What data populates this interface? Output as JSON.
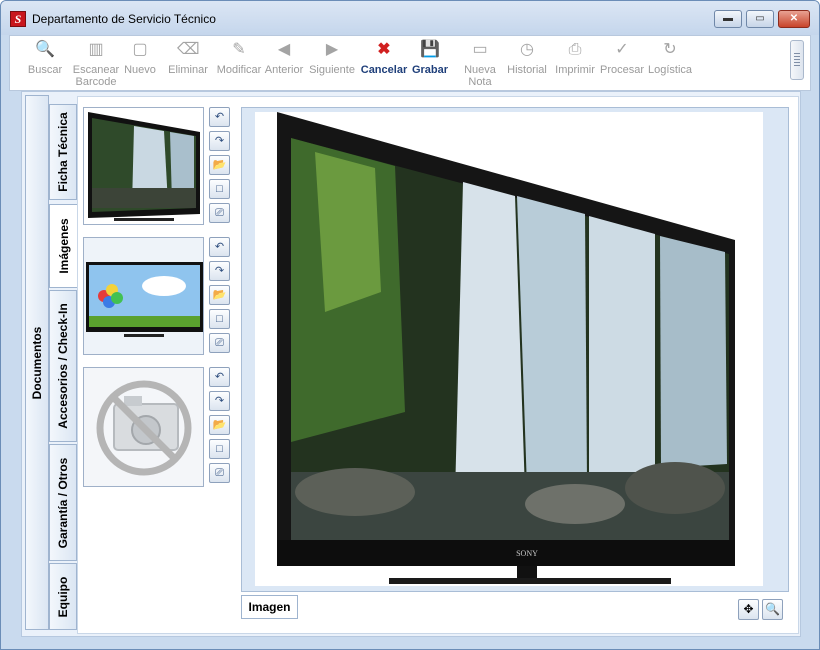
{
  "window": {
    "app_icon": "S",
    "title": "Departamento de Servicio Técnico",
    "controls": {
      "minimize": "▬",
      "maximize": "▭",
      "close": "✕"
    }
  },
  "toolbar": {
    "items": [
      {
        "label": "Buscar",
        "icon": "search-icon",
        "glyph": "🔍",
        "enabled": false
      },
      {
        "label": "Escanear",
        "label2": "Barcode",
        "icon": "barcode-icon",
        "glyph": "▥",
        "enabled": false
      },
      {
        "label": "Nuevo",
        "icon": "new-document-icon",
        "glyph": "▢",
        "enabled": false
      },
      {
        "label": "Eliminar",
        "icon": "delete-icon",
        "glyph": "⌫",
        "enabled": false
      },
      {
        "label": "Modificar",
        "icon": "edit-icon",
        "glyph": "✎",
        "enabled": false
      },
      {
        "label": "Anterior",
        "icon": "previous-icon",
        "glyph": "◀",
        "enabled": false
      },
      {
        "label": "Siguiente",
        "icon": "next-icon",
        "glyph": "▶",
        "enabled": false
      },
      {
        "label": "Cancelar",
        "icon": "cancel-icon",
        "glyph": "✖",
        "enabled": true
      },
      {
        "label": "Grabar",
        "icon": "save-icon",
        "glyph": "💾",
        "enabled": true
      },
      {
        "label": "Nueva",
        "label2": "Nota",
        "icon": "note-icon",
        "glyph": "▭",
        "enabled": false
      },
      {
        "label": "Historial",
        "icon": "history-icon",
        "glyph": "◷",
        "enabled": false
      },
      {
        "label": "Imprimir",
        "icon": "print-icon",
        "glyph": "⎙",
        "enabled": false
      },
      {
        "label": "Procesar",
        "icon": "checkmark-icon",
        "glyph": "✓",
        "enabled": false
      },
      {
        "label": "Logística",
        "icon": "refresh-icon",
        "glyph": "↻",
        "enabled": false
      }
    ]
  },
  "outer_tab": {
    "label": "Documentos"
  },
  "tabs": [
    {
      "label": "Ficha Técnica",
      "selected": false
    },
    {
      "label": "Imágenes",
      "selected": true
    },
    {
      "label": "Accesorios / Check-In",
      "selected": false
    },
    {
      "label": "Garantía / Otros",
      "selected": false
    },
    {
      "label": "Equipo",
      "selected": false
    }
  ],
  "thumb_buttons": [
    {
      "icon": "rotate-left-icon",
      "glyph": "↶"
    },
    {
      "icon": "rotate-right-icon",
      "glyph": "↷"
    },
    {
      "icon": "open-folder-icon",
      "glyph": "📂"
    },
    {
      "icon": "blank-frame-icon",
      "glyph": "□"
    },
    {
      "icon": "scanner-icon",
      "glyph": "⎚"
    }
  ],
  "image_label": "Imagen",
  "zoom_buttons": [
    {
      "icon": "move-icon",
      "glyph": "✥"
    },
    {
      "icon": "zoom-in-icon",
      "glyph": "🔍"
    }
  ],
  "tv": {
    "brand": "SONY"
  },
  "colors": {
    "window_bg": "#c9daee",
    "accent": "#1e4fa8",
    "cancel": "#d12020"
  }
}
